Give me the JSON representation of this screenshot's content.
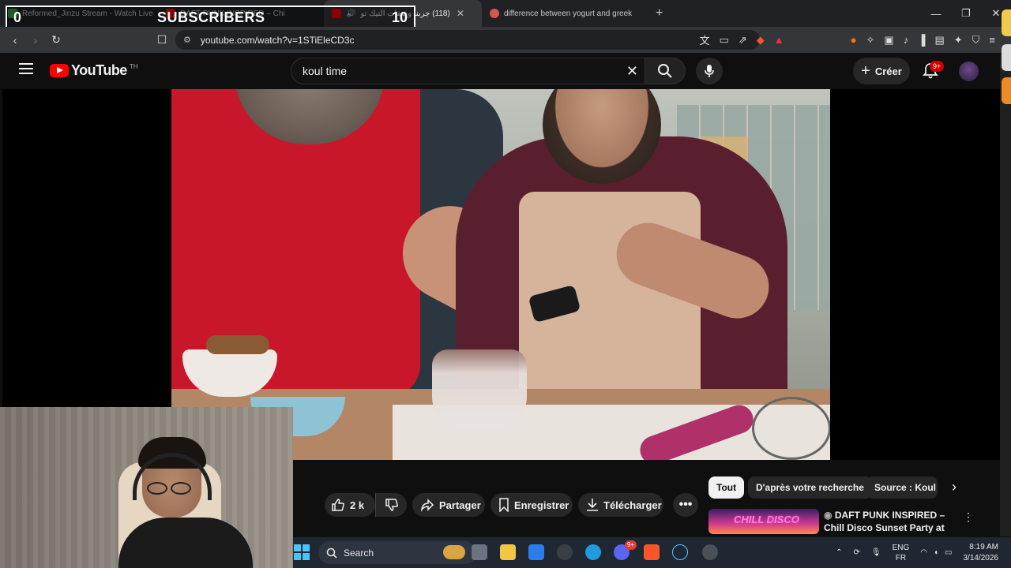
{
  "tabs": [
    {
      "label": "Reformed_Jinzu Stream - Watch Live",
      "icon": "twitch-icon"
    },
    {
      "label": "DAFT PUNK INSPIRED – Chi",
      "icon": "youtube-icon"
    },
    {
      "label": "(118) جربنا وصفات التيك تو",
      "icon": "youtube-icon"
    },
    {
      "label": "difference between yogurt and greek",
      "icon": "search-icon"
    }
  ],
  "overlay": {
    "left_count": "0",
    "label": "SUBSCRIBERS",
    "right_count": "10"
  },
  "address": {
    "url": "youtube.com/watch?v=1STiEleCD3c"
  },
  "youtube": {
    "logo_text": "YouTube",
    "country_code": "TH",
    "search_query": "koul time",
    "create_label": "Créer",
    "notification_count": "9+"
  },
  "actions": {
    "likes": "2 k",
    "share": "Partager",
    "save": "Enregistrer",
    "download": "Télécharger"
  },
  "chips": [
    "Tout",
    "D'après votre recherche",
    "Source : Koul Ti"
  ],
  "recommendation": {
    "thumb_text": "CHILL DISCO",
    "title": "DAFT PUNK INSPIRED – Chill Disco Sunset Party at ..."
  },
  "taskbar": {
    "search_label": "Search",
    "language": "ENG",
    "layout": "FR",
    "time": "8:19 AM",
    "date": "3/14/2026",
    "discord_badge": "9+"
  },
  "colors": {
    "yt_red": "#ff0000",
    "accent": "#3ea6ff"
  }
}
